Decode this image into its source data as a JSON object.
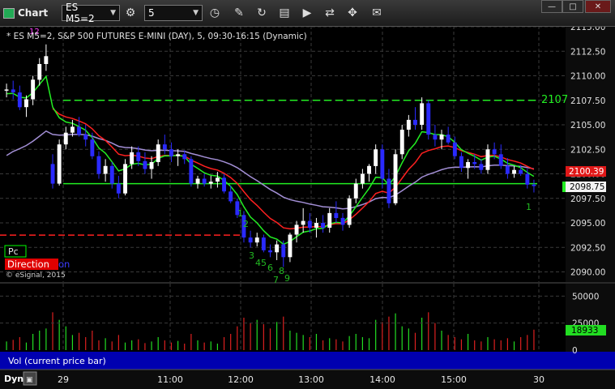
{
  "toolbar": {
    "title": "Chart",
    "symbol": "ES M5=2",
    "interval": "5",
    "window_controls": [
      "—",
      "□",
      "✕"
    ]
  },
  "header": {
    "marker": "12",
    "description": "* ES M5=2, S&P 500 FUTURES E-MINI (DAY), 5, 09:30-16:15 (Dynamic)"
  },
  "legend": {
    "pc": "Pc",
    "direction": "Direction",
    "direction_suffix": "on",
    "copyright": "© eSignal, 2015"
  },
  "price_axis": {
    "ticks": [
      "2115.00",
      "2112.50",
      "2110.00",
      "2107.50",
      "2105.00",
      "2102.50",
      "2100.00",
      "2097.50",
      "2095.00",
      "2092.50",
      "2090.00"
    ],
    "label_red": "2100.39",
    "label_white": "2098.75",
    "level_label": "2107"
  },
  "volume": {
    "label": "Vol (current price bar)",
    "ticks": [
      "50000",
      "25000",
      "0"
    ],
    "current": "18933"
  },
  "time_axis": {
    "dyn": "Dyn",
    "labels": [
      "29",
      "11:00",
      "12:00",
      "13:00",
      "14:00",
      "15:00",
      "30"
    ]
  },
  "annotations": {
    "counts": [
      "1",
      "2",
      "3",
      "4",
      "5",
      "6",
      "8",
      "7",
      "9"
    ],
    "right_count": "1"
  },
  "colors": {
    "up": "#ffffff",
    "down": "#2a2aff",
    "red": "#ff2020",
    "green": "#22ee22",
    "purple": "#a38fd6"
  },
  "chart_data": {
    "type": "candlestick",
    "y_range": [
      2089.5,
      2115.5
    ],
    "resistance_level": 2107.5,
    "support_level": 2093.75,
    "ohlc": [
      [
        2108.5,
        2109.2,
        2107.8,
        2108.6
      ],
      [
        2108.6,
        2109.5,
        2107.6,
        2108.3
      ],
      [
        2108.3,
        2109.0,
        2106.5,
        2106.8
      ],
      [
        2106.8,
        2108.0,
        2105.8,
        2107.6
      ],
      [
        2107.6,
        2110.0,
        2107.0,
        2109.6
      ],
      [
        2109.6,
        2111.8,
        2109.0,
        2111.2
      ],
      [
        2111.2,
        2113.2,
        2110.5,
        2112.0
      ],
      [
        2101.0,
        2102.0,
        2098.5,
        2099.0
      ],
      [
        2099.0,
        2103.5,
        2098.8,
        2103.0
      ],
      [
        2103.0,
        2104.8,
        2102.5,
        2104.2
      ],
      [
        2104.2,
        2105.5,
        2103.8,
        2104.8
      ],
      [
        2104.8,
        2105.8,
        2103.8,
        2104.0
      ],
      [
        2104.0,
        2105.0,
        2102.8,
        2103.5
      ],
      [
        2103.5,
        2104.2,
        2101.5,
        2101.8
      ],
      [
        2101.8,
        2102.3,
        2099.5,
        2100.0
      ],
      [
        2100.0,
        2101.5,
        2099.2,
        2100.8
      ],
      [
        2100.8,
        2101.2,
        2098.5,
        2099.0
      ],
      [
        2099.0,
        2099.8,
        2097.5,
        2098.0
      ],
      [
        2098.0,
        2101.5,
        2097.8,
        2101.0
      ],
      [
        2101.0,
        2102.8,
        2100.5,
        2102.2
      ],
      [
        2102.2,
        2102.8,
        2100.8,
        2101.3
      ],
      [
        2101.3,
        2102.2,
        2100.0,
        2100.5
      ],
      [
        2100.5,
        2101.8,
        2099.5,
        2101.2
      ],
      [
        2101.2,
        2103.5,
        2100.8,
        2103.0
      ],
      [
        2103.0,
        2104.0,
        2102.0,
        2102.5
      ],
      [
        2102.5,
        2103.2,
        2101.2,
        2101.8
      ],
      [
        2101.8,
        2102.5,
        2100.8,
        2102.0
      ],
      [
        2102.0,
        2102.4,
        2101.0,
        2101.5
      ],
      [
        2101.5,
        2101.8,
        2098.7,
        2099.0
      ],
      [
        2099.0,
        2099.8,
        2098.5,
        2099.5
      ],
      [
        2099.5,
        2100.0,
        2098.7,
        2099.0
      ],
      [
        2099.0,
        2099.8,
        2098.5,
        2099.2
      ],
      [
        2099.2,
        2100.2,
        2098.6,
        2099.6
      ],
      [
        2099.6,
        2100.0,
        2098.0,
        2098.2
      ],
      [
        2098.2,
        2098.8,
        2097.0,
        2097.2
      ],
      [
        2097.2,
        2097.5,
        2095.5,
        2095.8
      ],
      [
        2095.8,
        2096.2,
        2093.0,
        2093.5
      ],
      [
        2093.5,
        2094.2,
        2092.5,
        2093.0
      ],
      [
        2093.0,
        2094.0,
        2092.6,
        2093.5
      ],
      [
        2093.5,
        2093.8,
        2092.0,
        2092.2
      ],
      [
        2092.2,
        2092.8,
        2091.5,
        2092.0
      ],
      [
        2092.0,
        2093.2,
        2091.2,
        2092.8
      ],
      [
        2092.8,
        2093.2,
        2090.5,
        2091.5
      ],
      [
        2091.5,
        2094.0,
        2091.0,
        2093.8
      ],
      [
        2093.8,
        2095.2,
        2093.0,
        2094.8
      ],
      [
        2094.8,
        2096.5,
        2094.0,
        2095.2
      ],
      [
        2095.2,
        2096.0,
        2094.0,
        2094.5
      ],
      [
        2094.5,
        2095.5,
        2093.5,
        2095.0
      ],
      [
        2095.0,
        2095.8,
        2094.0,
        2094.5
      ],
      [
        2094.5,
        2096.5,
        2094.0,
        2096.0
      ],
      [
        2096.0,
        2097.2,
        2095.0,
        2095.5
      ],
      [
        2095.5,
        2096.0,
        2094.2,
        2094.8
      ],
      [
        2094.8,
        2097.8,
        2094.5,
        2097.5
      ],
      [
        2097.5,
        2099.5,
        2097.0,
        2099.0
      ],
      [
        2099.0,
        2100.5,
        2098.5,
        2100.0
      ],
      [
        2100.0,
        2101.0,
        2099.2,
        2100.8
      ],
      [
        2100.8,
        2103.0,
        2100.0,
        2102.5
      ],
      [
        2102.5,
        2103.0,
        2098.5,
        2099.5
      ],
      [
        2099.5,
        2100.5,
        2096.5,
        2097.0
      ],
      [
        2097.0,
        2102.5,
        2096.8,
        2102.0
      ],
      [
        2102.0,
        2105.0,
        2101.5,
        2104.5
      ],
      [
        2104.5,
        2106.0,
        2103.8,
        2105.5
      ],
      [
        2105.5,
        2106.8,
        2104.5,
        2105.0
      ],
      [
        2105.0,
        2107.8,
        2104.5,
        2107.2
      ],
      [
        2107.2,
        2107.5,
        2103.5,
        2104.0
      ],
      [
        2104.0,
        2105.0,
        2102.8,
        2103.5
      ],
      [
        2103.5,
        2104.5,
        2102.5,
        2104.0
      ],
      [
        2104.0,
        2104.8,
        2103.0,
        2103.2
      ],
      [
        2103.2,
        2103.8,
        2101.5,
        2101.8
      ],
      [
        2101.8,
        2102.2,
        2100.2,
        2100.6
      ],
      [
        2100.6,
        2101.5,
        2099.5,
        2101.2
      ],
      [
        2101.2,
        2102.0,
        2100.5,
        2101.0
      ],
      [
        2101.0,
        2101.5,
        2100.0,
        2100.4
      ],
      [
        2100.4,
        2103.0,
        2100.0,
        2102.5
      ],
      [
        2102.5,
        2103.2,
        2101.5,
        2102.0
      ],
      [
        2102.0,
        2103.0,
        2100.5,
        2100.8
      ],
      [
        2100.8,
        2101.6,
        2099.5,
        2100.0
      ],
      [
        2100.0,
        2100.8,
        2099.6,
        2100.4
      ],
      [
        2100.4,
        2100.9,
        2099.8,
        2100.0
      ],
      [
        2100.0,
        2100.5,
        2098.5,
        2098.9
      ],
      [
        2098.9,
        2099.4,
        2098.1,
        2098.75
      ]
    ],
    "volume": [
      8000,
      9500,
      12000,
      7000,
      15000,
      18000,
      20000,
      35000,
      28000,
      22000,
      14000,
      16000,
      12000,
      18000,
      9000,
      11000,
      8000,
      14000,
      7000,
      9000,
      10000,
      6500,
      8000,
      12000,
      9000,
      7000,
      8500,
      6000,
      15000,
      9000,
      7000,
      8000,
      6000,
      12000,
      15000,
      22000,
      30000,
      25000,
      28000,
      24000,
      20000,
      26000,
      31000,
      18000,
      16000,
      14000,
      12000,
      15000,
      9000,
      11000,
      10000,
      8000,
      13000,
      15000,
      12000,
      11000,
      28000,
      26000,
      31000,
      34000,
      22000,
      20000,
      16000,
      30000,
      35000,
      25000,
      18000,
      14000,
      12000,
      10000,
      15000,
      9000,
      8000,
      12000,
      10000,
      9000,
      11000,
      8000,
      12000,
      14000,
      18933
    ]
  }
}
